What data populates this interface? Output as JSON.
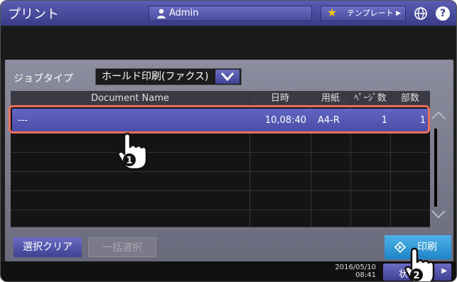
{
  "header": {
    "title": "プリント",
    "user": "Admin",
    "template_label": "テンプレート",
    "help": "?"
  },
  "filter": {
    "label": "ジョブタイプ",
    "selected": "ホールド印刷(ファクス)"
  },
  "table": {
    "columns": [
      "Document Name",
      "日時",
      "用紙",
      "ﾍﾟｰｼﾞ数",
      "部数"
    ],
    "rows": [
      {
        "name": "---",
        "datetime": "10,08:40",
        "paper": "A4-R",
        "pages": "1",
        "copies": "1",
        "selected": true
      }
    ]
  },
  "buttons": {
    "clear": "選択クリア",
    "select_all": "一括選択",
    "print": "印刷"
  },
  "footer": {
    "date": "2016/05/10",
    "time": "08:41",
    "status_button": "状"
  },
  "callouts": [
    "1",
    "2"
  ],
  "colors": {
    "accent": "#4a4ca6",
    "highlight": "#e8705a",
    "print_button": "#1f84c8"
  }
}
